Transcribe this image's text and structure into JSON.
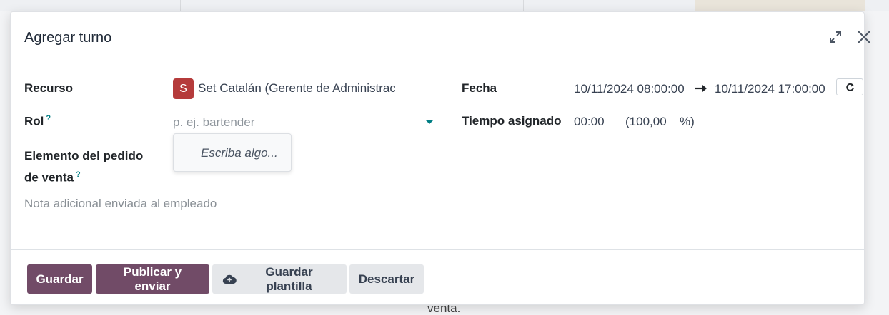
{
  "background": {
    "footer_text": "venta."
  },
  "dialog": {
    "title": "Agregar turno",
    "expand_icon": "expand-arrows-icon",
    "close_icon": "close-icon"
  },
  "form": {
    "resource": {
      "label": "Recurso",
      "avatar_letter": "S",
      "avatar_color": "#b53b3b",
      "value": "Set Catalán (Gerente de Administrac"
    },
    "role": {
      "label": "Rol",
      "help": "?",
      "placeholder": "p. ej. bartender",
      "value": "",
      "dropdown_hint": "Escriba algo..."
    },
    "sale_line": {
      "label_line1": "Elemento del pedido",
      "label_line2": "de venta",
      "help": "?"
    },
    "note_placeholder": "Nota adicional enviada al empleado",
    "date": {
      "label": "Fecha",
      "start": "10/11/2024 08:00:00",
      "end": "10/11/2024 17:00:00",
      "refresh_icon": "refresh-icon"
    },
    "allocated_time": {
      "label": "Tiempo asignado",
      "hours": "00:00",
      "percent_open": "(100,00",
      "percent_close": "%)"
    }
  },
  "footer": {
    "save_label": "Guardar",
    "publish_label": "Publicar y enviar",
    "save_template_label": "Guardar plantilla",
    "discard_label": "Descartar"
  },
  "colors": {
    "primary": "#714b67",
    "accent": "#017e84"
  }
}
